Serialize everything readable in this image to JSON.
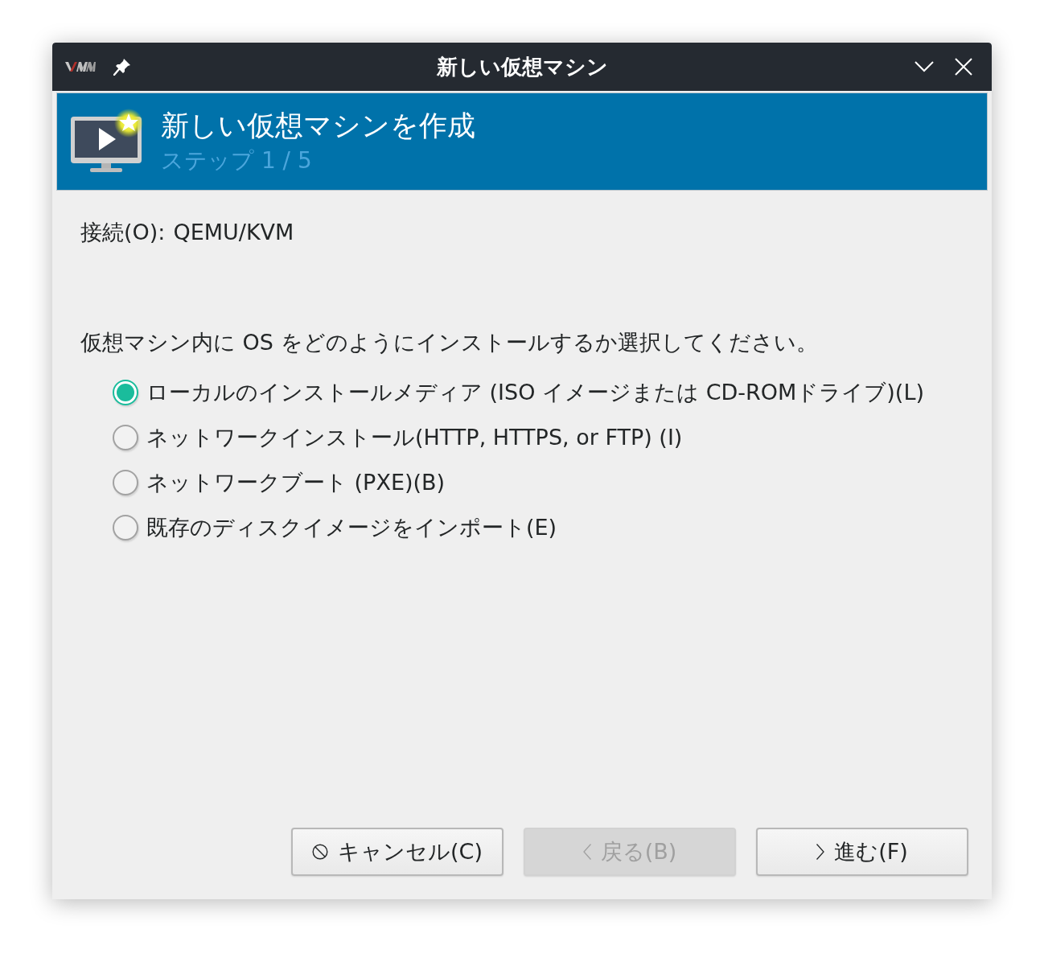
{
  "window": {
    "title": "新しい仮想マシン"
  },
  "header": {
    "title": "新しい仮想マシンを作成",
    "step": "ステップ 1 / 5"
  },
  "connection": {
    "label": "接続(O):",
    "value": "QEMU/KVM"
  },
  "prompt": "仮想マシン内に OS をどのようにインストールするか選択してください。",
  "options": [
    {
      "label": "ローカルのインストールメディア (ISO イメージまたは CD-ROMドライブ)(L)",
      "selected": true
    },
    {
      "label": "ネットワークインストール(HTTP, HTTPS, or FTP) (I)",
      "selected": false
    },
    {
      "label": "ネットワークブート (PXE)(B)",
      "selected": false
    },
    {
      "label": "既存のディスクイメージをインポート(E)",
      "selected": false
    }
  ],
  "buttons": [
    {
      "label": "キャンセル(C)",
      "kind": "cancel",
      "disabled": false
    },
    {
      "label": "戻る(B)",
      "kind": "back",
      "disabled": true
    },
    {
      "label": "進む(F)",
      "kind": "forward",
      "disabled": false
    }
  ]
}
